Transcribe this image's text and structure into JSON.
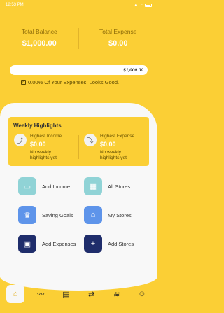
{
  "status": {
    "time": "12:53 PM"
  },
  "totals": {
    "balance_label": "Total Balance",
    "balance_value": "$1,000.00",
    "expense_label": "Total Expense",
    "expense_value": "$0.00"
  },
  "progress": {
    "amount": "$1,000.00",
    "percent_used": 0
  },
  "expense_note": "0.00% Of Your Expenses, Looks Good.",
  "weekly": {
    "title": "Weekly Highlights",
    "income": {
      "label": "Highest Income",
      "value": "$0.00",
      "sub": "No weekly highlights yet"
    },
    "expense": {
      "label": "Highest Expense",
      "value": "$0.00",
      "sub": "No weekly highlights yet"
    }
  },
  "actions": [
    {
      "label": "Add Income",
      "icon": "wallet-icon",
      "color": "#90d3d6"
    },
    {
      "label": "All Stores",
      "icon": "building-icon",
      "color": "#90d3d6"
    },
    {
      "label": "Saving Goals",
      "icon": "trophy-icon",
      "color": "#5e94ea"
    },
    {
      "label": "My Stores",
      "icon": "store-icon",
      "color": "#5e94ea"
    },
    {
      "label": "Add Expenses",
      "icon": "money-icon",
      "color": "#1f2d6b"
    },
    {
      "label": "Add Stores",
      "icon": "plus-icon",
      "color": "#1f2d6b"
    }
  ],
  "nav": [
    "home-icon",
    "trend-icon",
    "store-icon",
    "transfer-icon",
    "layers-icon",
    "profile-icon"
  ]
}
